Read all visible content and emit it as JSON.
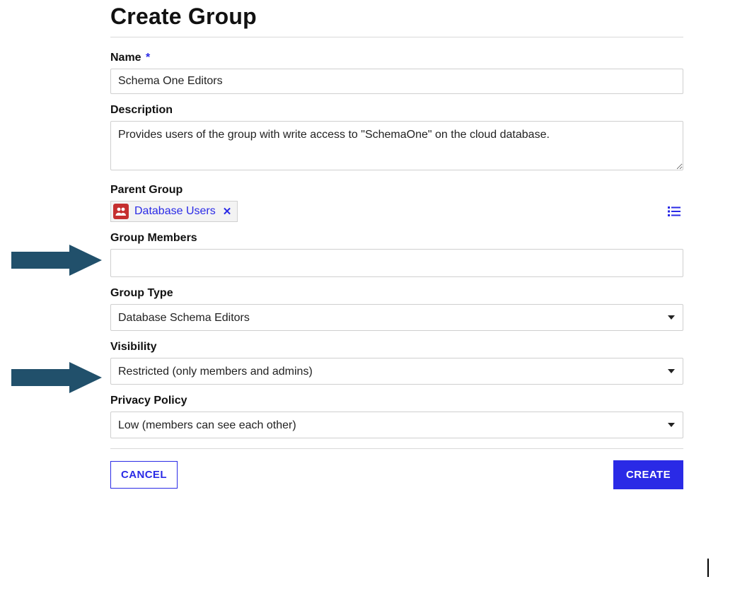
{
  "title": "Create Group",
  "fields": {
    "name": {
      "label": "Name",
      "required": "*",
      "value": "Schema One Editors"
    },
    "description": {
      "label": "Description",
      "value": "Provides users of the group with write access to \"SchemaOne\" on the cloud database."
    },
    "parent_group": {
      "label": "Parent Group",
      "chip_label": "Database Users"
    },
    "group_members": {
      "label": "Group Members"
    },
    "group_type": {
      "label": "Group Type",
      "selected": "Database Schema Editors"
    },
    "visibility": {
      "label": "Visibility",
      "selected": "Restricted (only members and admins)"
    },
    "privacy_policy": {
      "label": "Privacy Policy",
      "selected": "Low (members can see each other)"
    }
  },
  "footer": {
    "cancel": "CANCEL",
    "create": "CREATE"
  }
}
